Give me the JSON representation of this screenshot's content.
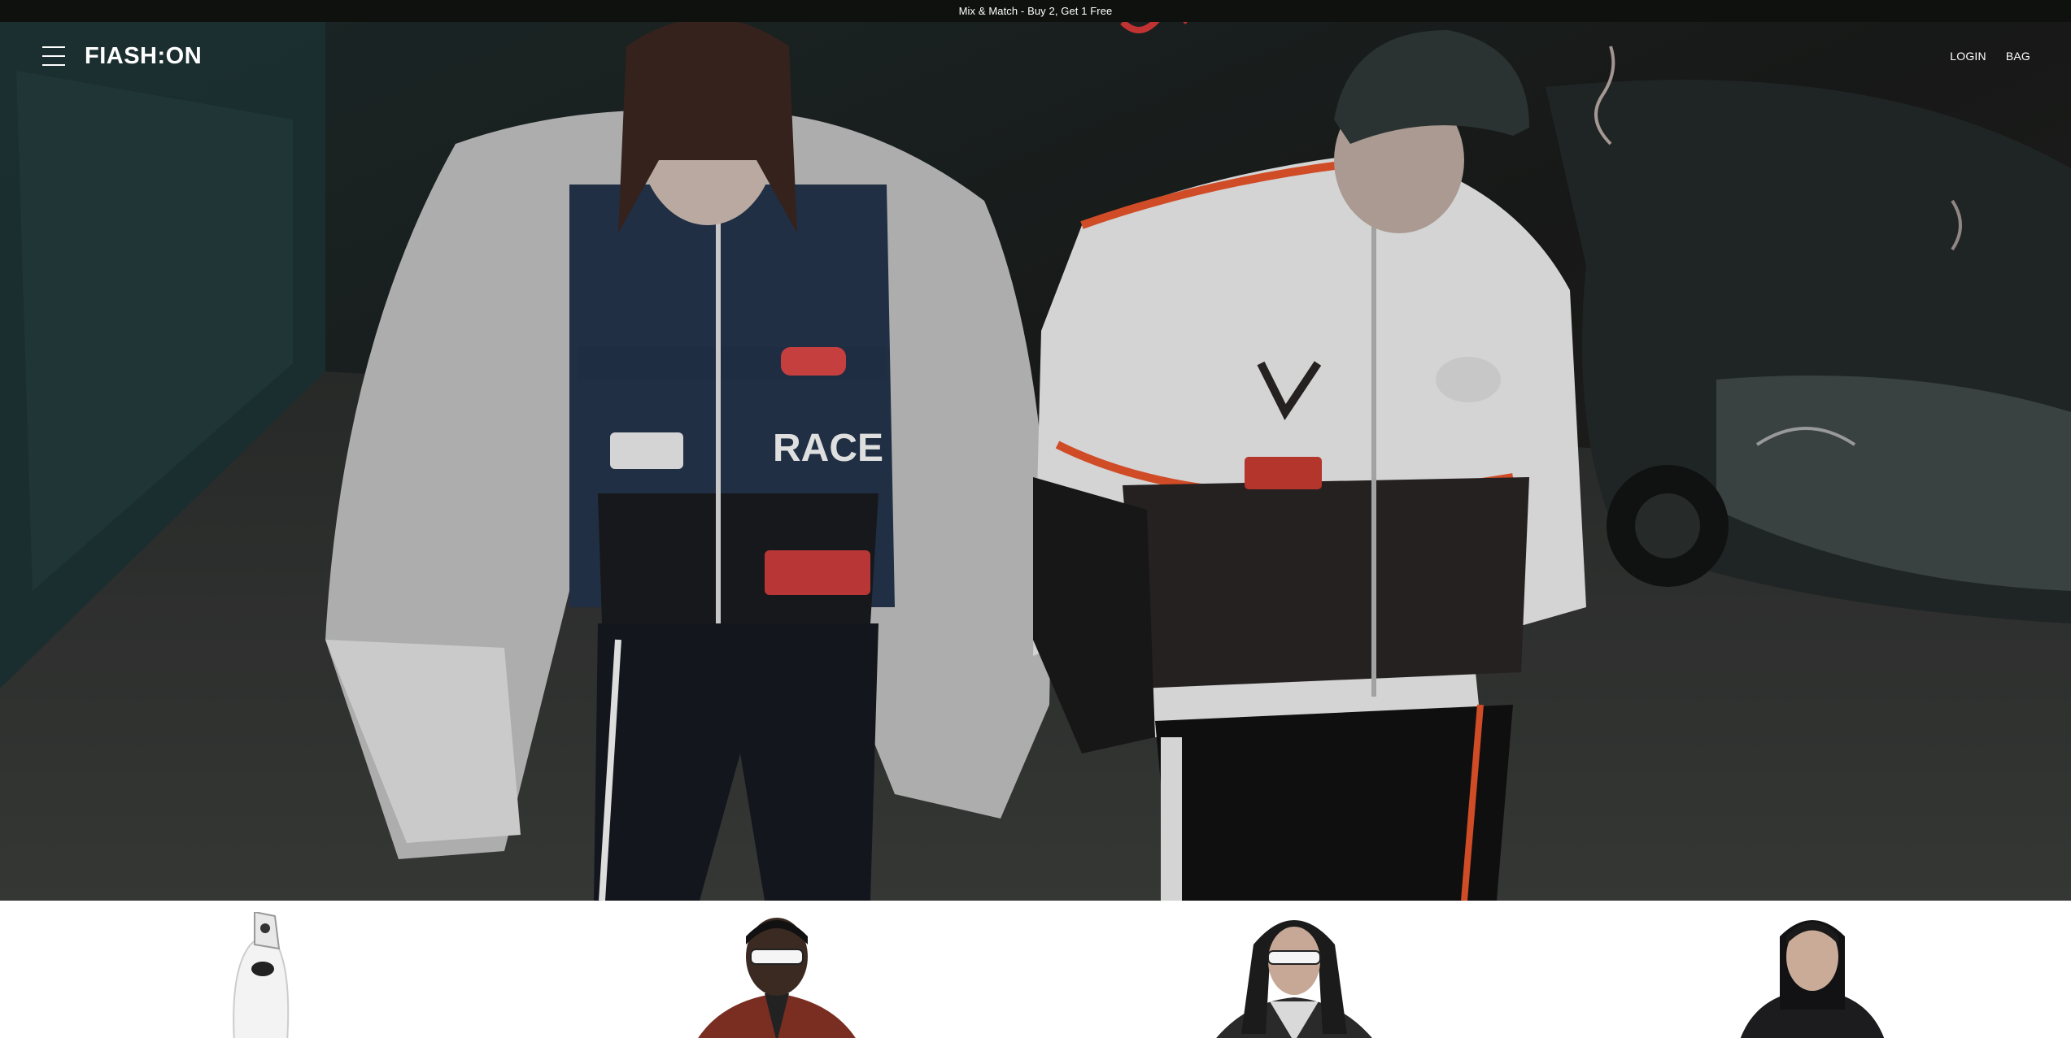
{
  "promo": {
    "text": "Mix & Match - Buy 2, Get 1 Free"
  },
  "header": {
    "logo": "FIASH:ON",
    "menu_icon": "hamburger-menu-icon",
    "links": {
      "login": "LOGIN",
      "bag": "BAG"
    }
  },
  "hero": {
    "image": "night street photo of two models in racing jackets",
    "patch_text": "RACE"
  },
  "products": [
    {
      "image": "white balaclava with glove"
    },
    {
      "image": "model with white sunglasses and burgundy varsity jacket"
    },
    {
      "image": "model with white sunglasses and grey jacket"
    },
    {
      "image": "model in black hooded jacket"
    }
  ],
  "colors": {
    "promo_bg": "#0f110f",
    "header_text": "#ffffff",
    "accent_orange": "#e2532b"
  }
}
